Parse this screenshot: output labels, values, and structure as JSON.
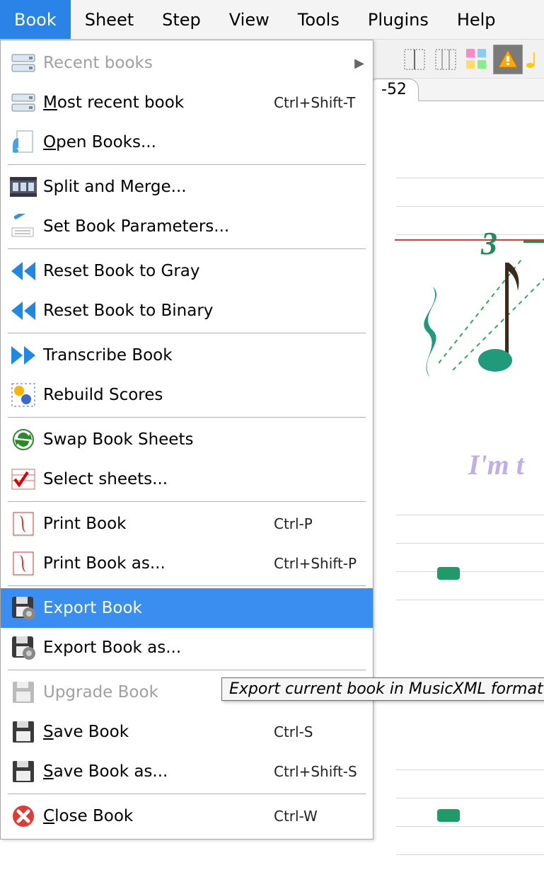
{
  "menubar": {
    "items": [
      {
        "label": "Book",
        "active": true
      },
      {
        "label": "Sheet"
      },
      {
        "label": "Step"
      },
      {
        "label": "View"
      },
      {
        "label": "Tools"
      },
      {
        "label": "Plugins"
      },
      {
        "label": "Help"
      }
    ]
  },
  "tab": {
    "visible_label": "-52"
  },
  "dropdown": {
    "items": [
      {
        "label": "Recent books",
        "icon": "drive",
        "disabled": true,
        "submenu": true
      },
      {
        "label_pre": "",
        "mnemonic": "M",
        "label_post": "ost recent book",
        "icon": "drive",
        "shortcut": "Ctrl+Shift-T"
      },
      {
        "label_pre": "",
        "mnemonic": "O",
        "label_post": "pen Books...",
        "icon": "music-page"
      },
      {
        "sep": true
      },
      {
        "label": "Split and Merge...",
        "icon": "film"
      },
      {
        "label": "Set Book Parameters...",
        "icon": "wand"
      },
      {
        "sep": true
      },
      {
        "label": "Reset Book to Gray",
        "icon": "rewind"
      },
      {
        "label": "Reset Book to Binary",
        "icon": "rewind"
      },
      {
        "sep": true
      },
      {
        "label": "Transcribe Book",
        "icon": "fastfwd"
      },
      {
        "label": "Rebuild Scores",
        "icon": "rebuild"
      },
      {
        "sep": true
      },
      {
        "label": "Swap Book Sheets",
        "icon": "swap"
      },
      {
        "label": "Select sheets...",
        "icon": "select-sheets"
      },
      {
        "sep": true
      },
      {
        "label": "Print Book",
        "icon": "pdf",
        "shortcut": "Ctrl-P"
      },
      {
        "label": "Print Book as...",
        "icon": "pdf",
        "shortcut": "Ctrl+Shift-P"
      },
      {
        "sep": true
      },
      {
        "label": "Export Book",
        "icon": "save-gear",
        "highlight": true
      },
      {
        "label": "Export Book as...",
        "icon": "save-gear"
      },
      {
        "sep": true
      },
      {
        "label": "Upgrade Book",
        "icon": "floppy",
        "disabled": true
      },
      {
        "label_pre": "",
        "mnemonic": "S",
        "label_post": "ave Book",
        "icon": "floppy",
        "shortcut": "Ctrl-S"
      },
      {
        "label_pre": "",
        "mnemonic": "S",
        "label_post": "ave Book as...",
        "icon": "floppy",
        "shortcut": "Ctrl+Shift-S"
      },
      {
        "sep": true
      },
      {
        "label_pre": "",
        "mnemonic": "C",
        "label_post": "lose Book",
        "icon": "close-red",
        "shortcut": "Ctrl-W"
      }
    ]
  },
  "tooltip": {
    "text": "Export current book in MusicXML format"
  },
  "content": {
    "triplet_label": "3",
    "lyric": "I'm t"
  }
}
